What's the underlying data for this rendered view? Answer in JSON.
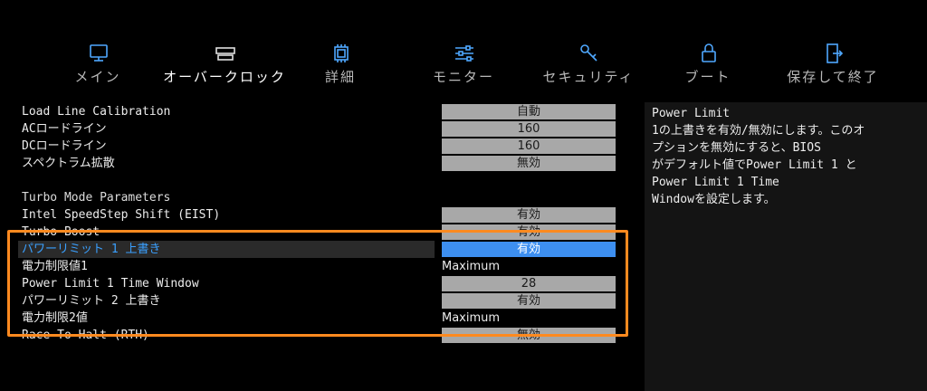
{
  "nav": {
    "tabs": [
      {
        "label": "メイン",
        "icon": "monitor-icon"
      },
      {
        "label": "オーバークロック",
        "icon": "memory-module-icon"
      },
      {
        "label": "詳細",
        "icon": "chip-icon"
      },
      {
        "label": "モニター",
        "icon": "sliders-icon"
      },
      {
        "label": "セキュリティ",
        "icon": "key-icon"
      },
      {
        "label": "ブート",
        "icon": "lock-icon"
      },
      {
        "label": "保存して終了",
        "icon": "exit-door-icon"
      }
    ],
    "active_index": 1
  },
  "settings": {
    "load_line": {
      "label": "Load Line Calibration",
      "value": "自動"
    },
    "ac_loadline": {
      "label": "ACロードライン",
      "value": "160"
    },
    "dc_loadline": {
      "label": "DCロードライン",
      "value": "160"
    },
    "spread_spectrum": {
      "label": "スペクトラム拡散",
      "value": "無効"
    },
    "turbo_heading": {
      "label": "Turbo Mode Parameters"
    },
    "eist": {
      "label": "Intel SpeedStep Shift (EIST)",
      "value": "有効"
    },
    "turbo_boost": {
      "label": "Turbo Boost",
      "value": "有効"
    },
    "pl1_override": {
      "label": "パワーリミット 1 上書き",
      "value": "有効"
    },
    "pl1_value": {
      "label": "電力制限値1",
      "value": "Maximum"
    },
    "pl1_time": {
      "label": "Power Limit 1 Time Window",
      "value": "28"
    },
    "pl2_override": {
      "label": "パワーリミット 2 上書き",
      "value": "有効"
    },
    "pl2_value": {
      "label": "電力制限2値",
      "value": "Maximum"
    },
    "race_to_halt": {
      "label": "Race To Halt (RTH)",
      "value": "無効"
    }
  },
  "help": {
    "title": "Power Limit",
    "lines": [
      "1の上書きを有効/無効にします。このオ",
      "プションを無効にすると、BIOS",
      "がデフォルト値でPower Limit 1 と",
      "Power Limit 1 Time",
      "Windowを設定します。"
    ]
  },
  "colors": {
    "highlight": "#3d8ff0",
    "frame": "#ff8a1f"
  }
}
